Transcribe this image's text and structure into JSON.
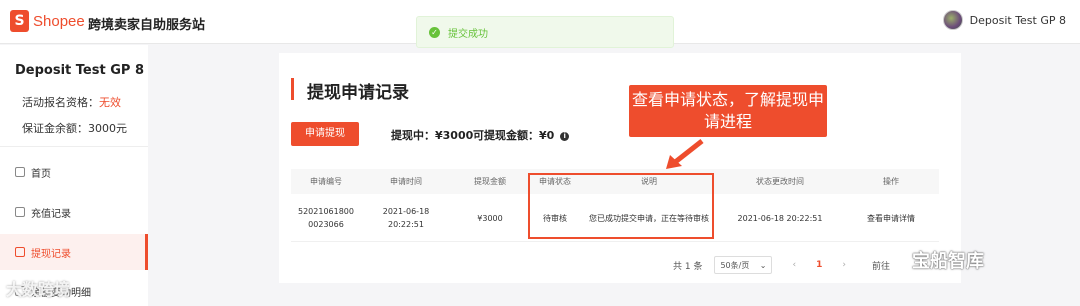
{
  "header": {
    "logo_text": "Shopee",
    "logo_glyph": "S",
    "site_title": "跨境卖家自助服务站",
    "user_name": "Deposit Test GP 8"
  },
  "toast": {
    "text": "提交成功",
    "icon": "check-circle-icon",
    "color": "#67c23a"
  },
  "sidebar": {
    "shop_name": "Deposit Test GP 8",
    "eligibility_label": "活动报名资格：",
    "eligibility_value": "无效",
    "deposit_label": "保证金余额：",
    "deposit_value": "3000元",
    "items": [
      {
        "label": "首页",
        "icon": "home-icon"
      },
      {
        "label": "充值记录",
        "icon": "recharge-icon"
      },
      {
        "label": "提现记录",
        "icon": "withdraw-icon",
        "active": true
      },
      {
        "label": "余额变动明细",
        "icon": "list-icon"
      }
    ]
  },
  "main": {
    "title": "提现申请记录",
    "apply_button": "申请提现",
    "withdrawing": "提现中：¥3000",
    "withdrawable": "可提现金额：¥0",
    "table": {
      "headers": [
        "申请编号",
        "申请时间",
        "提现金额",
        "申请状态",
        "说明",
        "状态更改时间",
        "操作"
      ],
      "rows": [
        [
          "52021061800 0023066",
          "2021-06-18 20:22:51",
          "¥3000",
          "待审核",
          "您已成功提交申请，正在等待审核",
          "2021-06-18 20:22:51",
          "查看申请详情"
        ]
      ]
    },
    "pagination": {
      "total": "共 1 条",
      "page_size": "50条/页",
      "current_page": "1",
      "goto": "前往"
    }
  },
  "annotation": {
    "callout": "查看申请状态，了解提现申请进程",
    "color": "#ee4d2d"
  },
  "watermarks": {
    "left": "大数跨境",
    "right": "宝船智库"
  },
  "brand_color": "#ee4d2d"
}
